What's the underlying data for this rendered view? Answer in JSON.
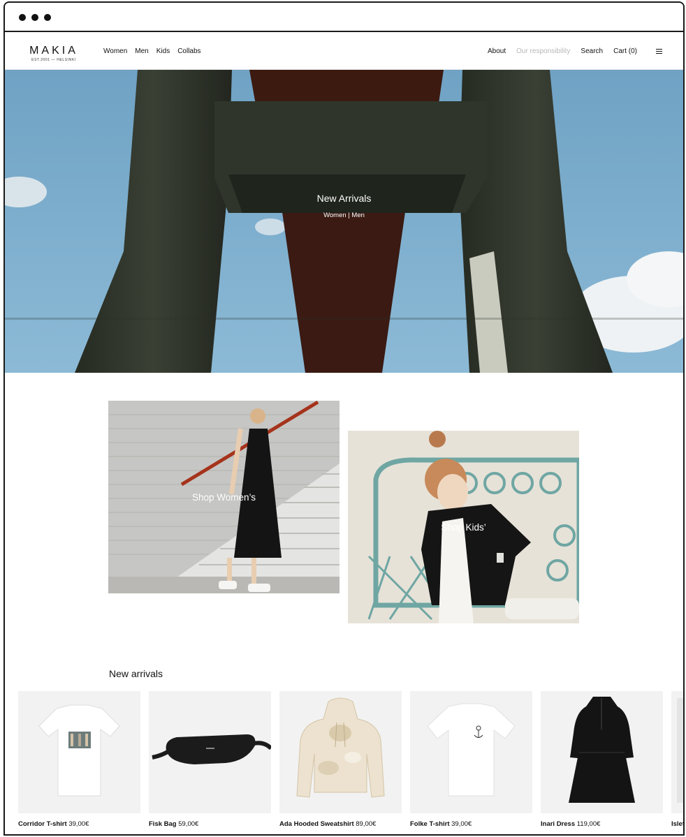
{
  "brand": {
    "name": "MAKIA",
    "tagline": "EST.2001 — HELSINKI"
  },
  "nav": {
    "left": [
      "Women",
      "Men",
      "Kids",
      "Collabs"
    ],
    "right": {
      "about": "About",
      "responsibility": "Our responsibility",
      "search": "Search",
      "cart": "Cart (0)"
    }
  },
  "hero": {
    "title": "New Arrivals",
    "link_women": "Women",
    "separator": " | ",
    "link_men": "Men"
  },
  "promos": {
    "women": "Shop Women’s",
    "kids": "Shop Kids’"
  },
  "new_arrivals": {
    "title": "New arrivals",
    "products": [
      {
        "name": "Corridor T-shirt",
        "price": "39,00€"
      },
      {
        "name": "Fisk Bag",
        "price": "59,00€"
      },
      {
        "name": "Ada Hooded Sweatshirt",
        "price": "89,00€"
      },
      {
        "name": "Folke T-shirt",
        "price": "39,00€"
      },
      {
        "name": "Inari Dress",
        "price": "119,00€"
      },
      {
        "name": "Islet",
        "price": ""
      }
    ]
  },
  "colors": {
    "sky": "#79aacb",
    "concrete": "#2d3329",
    "accent_red": "#3a1a12",
    "muted_nav": "#b8b8b8"
  },
  "icons": [
    "window-dot-icon",
    "menu-icon"
  ]
}
